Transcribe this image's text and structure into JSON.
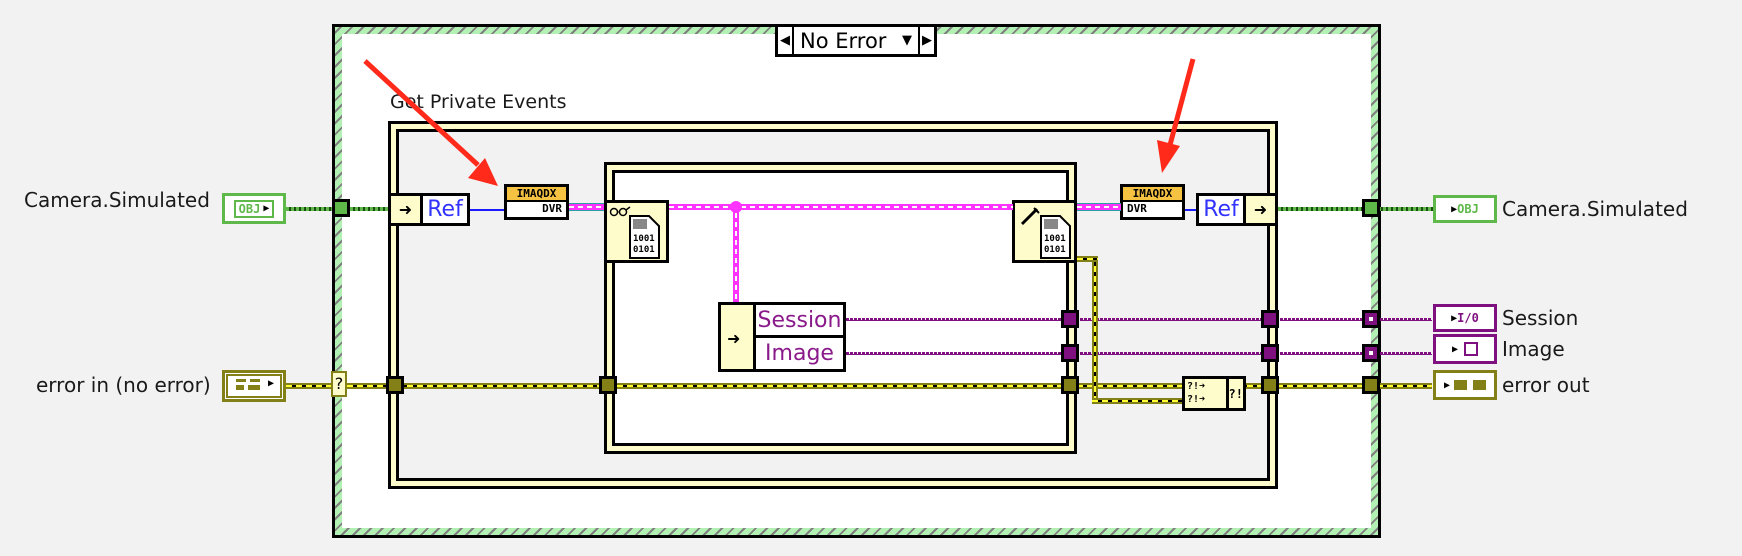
{
  "case_structure": {
    "selector_value": "No Error",
    "decrement_icon": "left-triangle-icon",
    "increment_icon": "right-triangle-icon",
    "dropdown_icon": "down-triangle-icon"
  },
  "ipe_structure": {
    "label": "Get Private Events",
    "in_ref_label": "Ref",
    "out_ref_label": "Ref",
    "dvr_in": {
      "type_label": "IMAQDX",
      "value_label": "DVR"
    },
    "dvr_out": {
      "type_label": "IMAQDX",
      "value_label": "DVR"
    }
  },
  "unbundle": {
    "fields": [
      "Session",
      "Image"
    ]
  },
  "merge_errors": {
    "glyph": "?!"
  },
  "controls": {
    "camera_in": {
      "label": "Camera.Simulated",
      "terminal_text": "OBJ"
    },
    "error_in": {
      "label": "error in (no error)"
    }
  },
  "indicators": {
    "camera_out": {
      "label": "Camera.Simulated",
      "terminal_text": "OBJ"
    },
    "session": {
      "label": "Session",
      "terminal_text": "I/0"
    },
    "image": {
      "label": "Image"
    },
    "error_out": {
      "label": "error out"
    }
  },
  "annotations": {
    "arrow_color": "#ff2a1a",
    "count": 2
  },
  "colors": {
    "class_wire": "#5fb84a",
    "error_wire": "#828016",
    "dvr_wire": "#ff33ff",
    "cluster_wire": "#7f1080",
    "structure_fill": "#fffccc"
  }
}
